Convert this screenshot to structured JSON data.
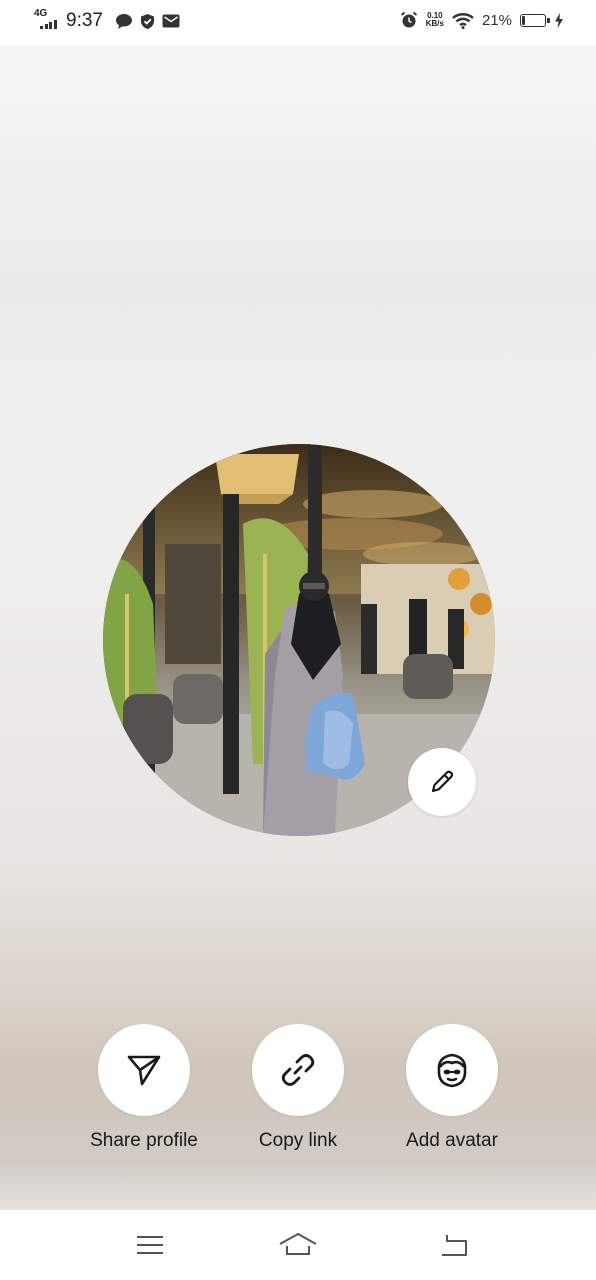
{
  "status_bar": {
    "network": "4G",
    "time": "9:37",
    "notification_icons": [
      "chat-icon",
      "shield-check-icon",
      "email-icon"
    ],
    "alarm_icon": "alarm-icon",
    "speed_value": "0.10",
    "speed_unit": "KB/s",
    "wifi_icon": "wifi-icon",
    "battery_percent": "21%",
    "battery_level": 0.21,
    "charging_icon": "lightning-icon"
  },
  "profile": {
    "photo": "profile-photo",
    "edit_icon": "pencil-icon"
  },
  "actions": [
    {
      "label": "Share profile",
      "icon": "send-icon"
    },
    {
      "label": "Copy link",
      "icon": "link-icon"
    },
    {
      "label": "Add avatar",
      "icon": "avatar-face-icon"
    }
  ],
  "nav_bar": {
    "items": [
      "menu-icon",
      "home-icon",
      "back-icon"
    ]
  },
  "colors": {
    "background_top": "#f5f5f4",
    "background_bottom": "#cfc5bb",
    "button_bg": "#ffffff",
    "icon_color": "#1a1a1a"
  }
}
